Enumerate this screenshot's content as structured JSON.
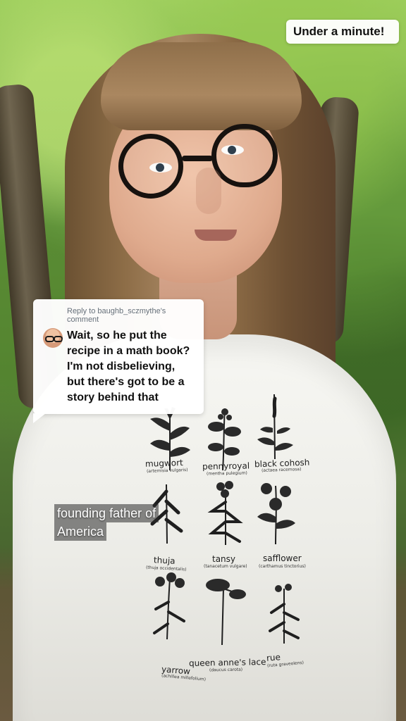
{
  "overlay": {
    "badge_text": "Under a minute!"
  },
  "reply": {
    "label_lines": [
      "Reply to baughb_sczmythe's",
      "comment"
    ],
    "comment_lines": [
      "Wait, so he put the",
      "recipe in a math book?",
      "I'm not disbelieving,",
      "but there's got to be a",
      "story behind that"
    ]
  },
  "caption": {
    "lines": [
      "founding father of",
      "America"
    ]
  },
  "shirt": {
    "plants": [
      {
        "name": "mugwort",
        "latin": "(artemisia vulgaris)"
      },
      {
        "name": "pennyroyal",
        "latin": "(mentha pulegium)"
      },
      {
        "name": "black cohosh",
        "latin": "(actaea racemosa)"
      },
      {
        "name": "thuja",
        "latin": "(thuja occidentalis)"
      },
      {
        "name": "tansy",
        "latin": "(tanacetum vulgare)"
      },
      {
        "name": "safflower",
        "latin": "(carthamus tinctorius)"
      },
      {
        "name": "yarrow",
        "latin": "(achillea millefolium)"
      },
      {
        "name": "queen anne's lace",
        "latin": "(daucus carota)"
      },
      {
        "name": "rue",
        "latin": "(ruta graveolens)"
      }
    ]
  },
  "colors": {
    "badge_bg": "#ffffff",
    "badge_text": "#111111",
    "reply_bg": "#ffffff",
    "reply_meta": "#66707a",
    "caption_bg": "#2c2c2c",
    "shirt": "#f3f2ee"
  },
  "icons": {
    "avatar": "avatar-icon"
  }
}
